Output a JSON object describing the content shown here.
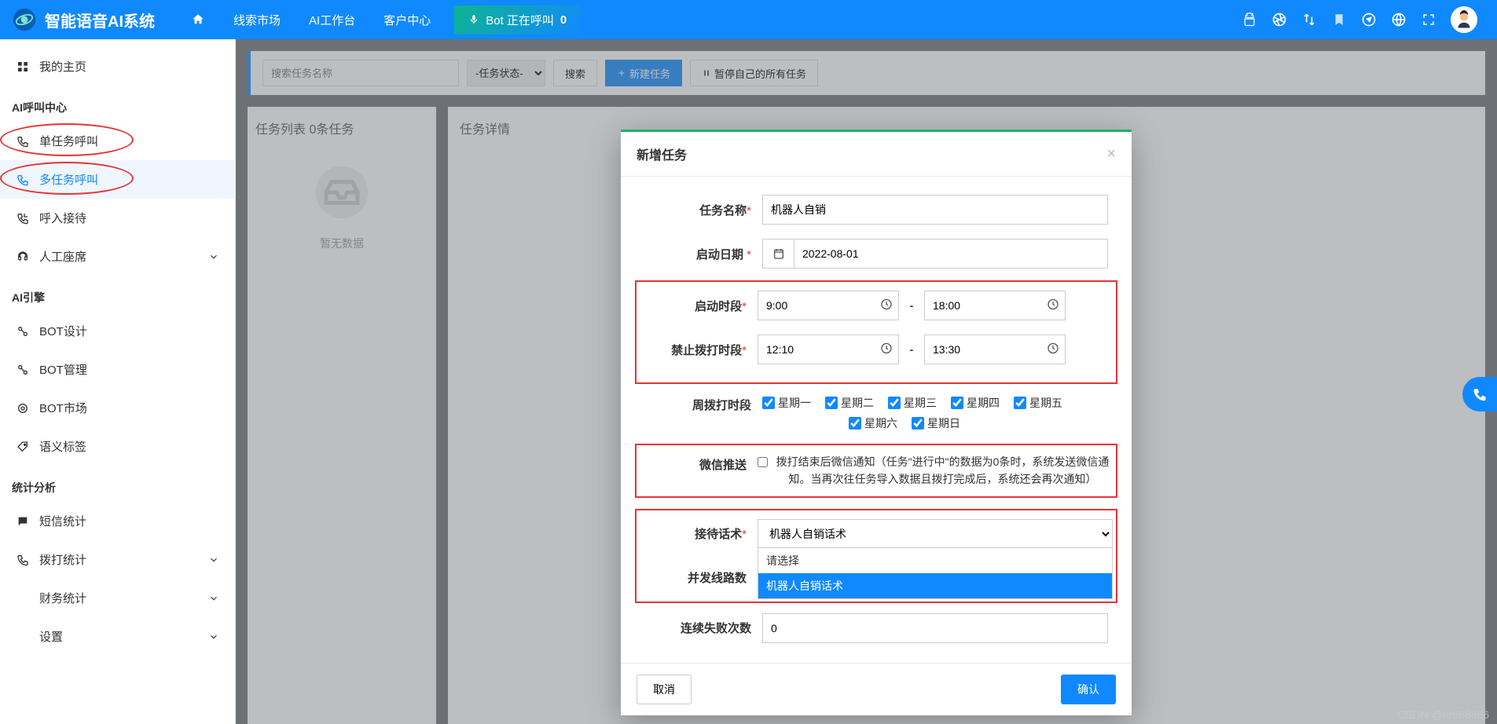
{
  "header": {
    "brand": "智能语音AI系统",
    "nav": {
      "home_icon": "home",
      "leads_market": "线索市场",
      "ai_workbench": "AI工作台",
      "customer_center": "客户中心"
    },
    "bot_calling": {
      "mic_icon": "mic",
      "label": "Bot 正在呼叫",
      "count": "0"
    }
  },
  "sidebar": {
    "my_home": "我的主页",
    "section_ai_call": "AI呼叫中心",
    "single_task_call": "单任务呼叫",
    "multi_task_call": "多任务呼叫",
    "inbound": "呼入接待",
    "manual_seat": "人工座席",
    "section_ai_engine": "AI引擎",
    "bot_design": "BOT设计",
    "bot_manage": "BOT管理",
    "bot_market": "BOT市场",
    "semantic_tag": "语义标签",
    "section_stats": "统计分析",
    "sms_stats": "短信统计",
    "dial_stats": "拨打统计",
    "finance_stats": "财务统计",
    "settings": "设置"
  },
  "toolbar": {
    "search_placeholder": "搜索任务名称",
    "status_placeholder": "-任务状态-",
    "search_btn": "搜索",
    "new_task_btn": "新建任务",
    "pause_all_btn": "暂停自己的所有任务"
  },
  "panels": {
    "task_list_title": "任务列表 0条任务",
    "task_detail_title": "任务详情",
    "empty_text": "暂无数据"
  },
  "modal": {
    "title": "新增任务",
    "labels": {
      "task_name": "任务名称",
      "start_date": "启动日期",
      "start_time": "启动时段",
      "forbid_time": "禁止拨打时段",
      "week_days": "周拨打时段",
      "wechat_push": "微信推送",
      "script": "接待话术",
      "lines": "并发线路数",
      "fail_count": "连续失败次数"
    },
    "values": {
      "task_name": "机器人自销",
      "start_date": "2022-08-01",
      "start_time_from": "9:00",
      "start_time_to": "18:00",
      "forbid_time_from": "12:10",
      "forbid_time_to": "13:30",
      "fail_count": "0"
    },
    "days": {
      "mon": "星期一",
      "tue": "星期二",
      "wed": "星期三",
      "thu": "星期四",
      "fri": "星期五",
      "sat": "星期六",
      "sun": "星期日"
    },
    "wechat_desc": "拨打结束后微信通知（任务\"进行中\"的数据为0条时，系统发送微信通知。当再次往任务导入数据且拨打完成后，系统还会再次通知）",
    "script_select": {
      "selected": "机器人自销话术",
      "opt_placeholder": "请选择",
      "opt1": "机器人自销话术"
    },
    "footer": {
      "cancel": "取消",
      "confirm": "确认"
    }
  },
  "watermark": "CSDN @hr668866"
}
